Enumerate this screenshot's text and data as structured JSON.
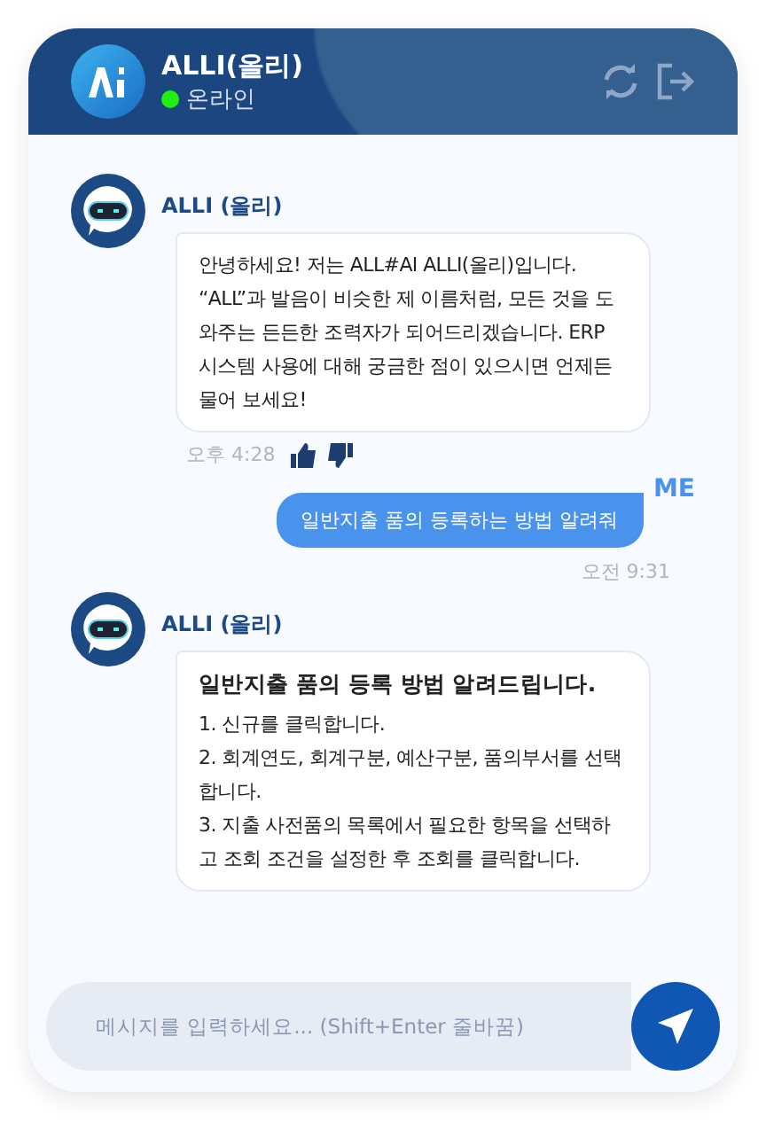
{
  "header": {
    "title": "ALLI(올리)",
    "status": "온라인",
    "online": true
  },
  "messages": [
    {
      "kind": "bot",
      "sender": "ALLI (올리)",
      "text": "안녕하세요! 저는 ALL#AI ALLI(올리)입니다. “ALL”과 발음이 비슷한 제 이름처럼, 모든 것을 도와주는 든든한 조력자가 되어드리겠습니다. ERP 시스템 사용에 대해 궁금한 점이 있으시면 언제든 물어 보세요!",
      "time": "오후 4:28"
    },
    {
      "kind": "user",
      "sender": "ME",
      "text": "일반지출 품의 등록하는 방법 알려줘",
      "time": "오전 9:31"
    },
    {
      "kind": "bot_steps",
      "sender": "ALLI (올리)",
      "title": "일반지출 품의 등록 방법 알려드립니다.",
      "steps": [
        "1. 신규를 클릭합니다.",
        "2. 회계연도, 회계구분, 예산구분, 품의부서를 선택합니다.",
        "3. 지출 사전품의 목록에서 필요한 항목을 선택하고 조회 조건을 설정한 후 조회를 클릭합니다."
      ]
    }
  ],
  "composer": {
    "placeholder": "메시지를 입력하세요... (Shift+Enter 줄바꿈)"
  }
}
